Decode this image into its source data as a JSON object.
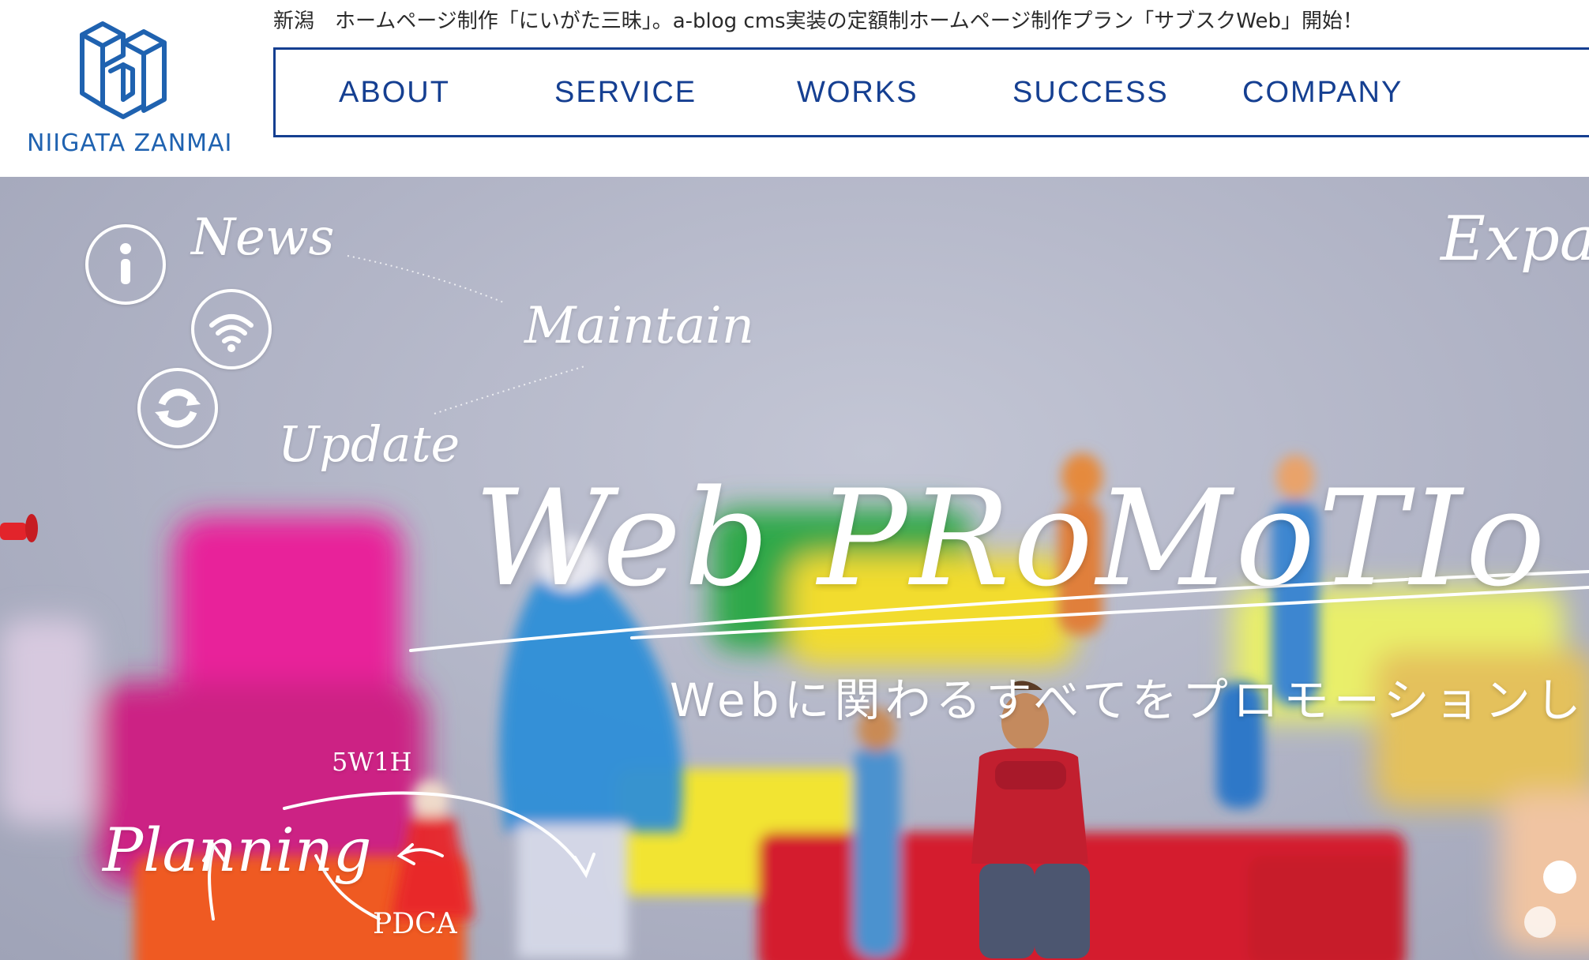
{
  "header": {
    "logo_text": "NIIGATA ZANMAI",
    "announcement": "新潟　ホームページ制作「にいがた三昧」。a-blog cms実装の定額制ホームページ制作プラン「サブスクWeb」開始！"
  },
  "nav": {
    "items": [
      {
        "label": "ABOUT"
      },
      {
        "label": "SERVICE"
      },
      {
        "label": "WORKS"
      },
      {
        "label": "SUCCESS"
      },
      {
        "label": "COMPANY"
      }
    ]
  },
  "hero": {
    "news": "News",
    "maintain": "Maintain",
    "update": "Update",
    "expand": "Expa",
    "title": "Web PRoMoTIo",
    "subtitle": "Webに関わるすべてをプロモーションしま",
    "planning": "Planning",
    "w5h1": "5W1H",
    "pdca": "PDCA",
    "slide_count": 2,
    "active_slide": 1
  },
  "colors": {
    "brand_blue": "#1f62b0",
    "nav_blue": "#153f91"
  }
}
